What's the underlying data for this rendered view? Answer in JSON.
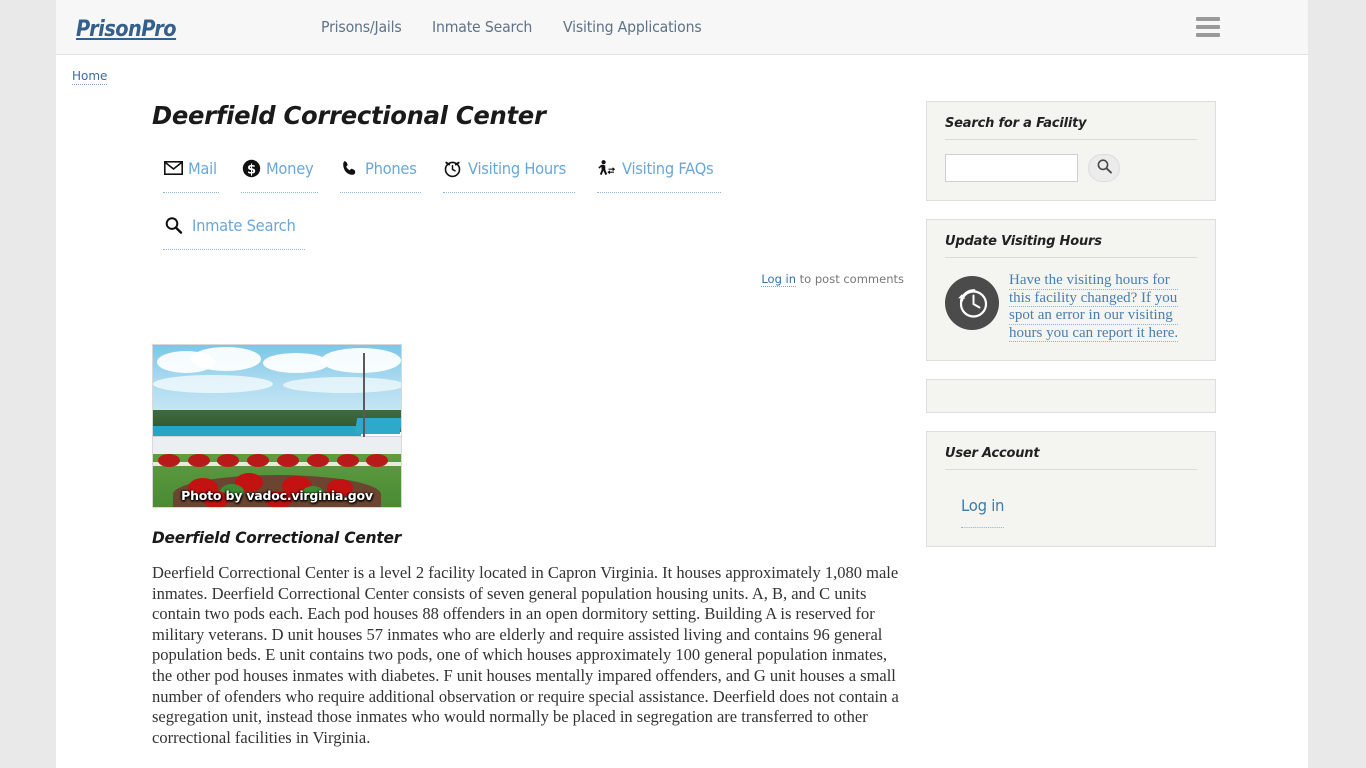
{
  "header": {
    "brand": "PrisonPro",
    "nav": [
      {
        "label": "Prisons/Jails"
      },
      {
        "label": "Inmate Search"
      },
      {
        "label": "Visiting Applications"
      }
    ],
    "menu_icon": "hamburger-icon"
  },
  "breadcrumb": {
    "home": "Home"
  },
  "main": {
    "title": "Deerfield Correctional Center",
    "icon_links_row1": [
      {
        "label": "Mail",
        "icon": "envelope-icon"
      },
      {
        "label": "Money",
        "icon": "dollar-circle-icon"
      },
      {
        "label": "Phones",
        "icon": "phone-icon"
      },
      {
        "label": "Visiting Hours",
        "icon": "alarm-clock-icon"
      },
      {
        "label": "Visiting FAQs",
        "icon": "walking-person-icon"
      }
    ],
    "icon_links_row2": [
      {
        "label": "Inmate Search",
        "icon": "search-icon"
      }
    ],
    "comments": {
      "login_label": "Log in",
      "suffix": " to post comments"
    },
    "photo": {
      "caption": "Photo by vadoc.virginia.gov"
    },
    "sub_heading": "Deerfield Correctional Center",
    "body": "Deerfield Correctional Center is a level 2 facility located in Capron Virginia.  It houses approximately 1,080 male inmates.  Deerfield Correctional Center consists of seven general population housing units.  A, B, and C units contain two pods each.  Each pod houses 88 offenders in an open dormitory setting.  Building A is reserved for military veterans.  D unit houses 57 inmates who are elderly and require assisted living and contains 96 general population beds.  E unit contains two pods, one of which houses approximately 100 general population inmates, the other pod houses inmates with diabetes.  F unit houses mentally impared offenders, and G unit houses a small number of ofenders who require additional observation or require special assistance.  Deerfield does not contain a segregation unit, instead those inmates who would normally be placed in segregation are transferred to other correctional facilities in Virginia."
  },
  "sidebar": {
    "search_panel": {
      "title": "Search for a Facility",
      "input_value": "",
      "input_placeholder": "",
      "button_icon": "search-icon"
    },
    "update_hours_panel": {
      "title": "Update Visiting Hours",
      "icon": "clock-arrow-icon",
      "link_lines": [
        "Have the visiting hours for",
        "this facility changed?  If you",
        "spot an error in our visiting",
        "hours you can report it here."
      ]
    },
    "empty_panel": {
      "content": ""
    },
    "user_account_panel": {
      "title": "User Account",
      "login_label": "Log in"
    }
  },
  "colors": {
    "brand": "#33608c",
    "link": "#6aa7d8",
    "page_bg": "#e9e9e9",
    "panel_bg": "#f4f4f0",
    "header_bg": "#f7f7f7"
  }
}
